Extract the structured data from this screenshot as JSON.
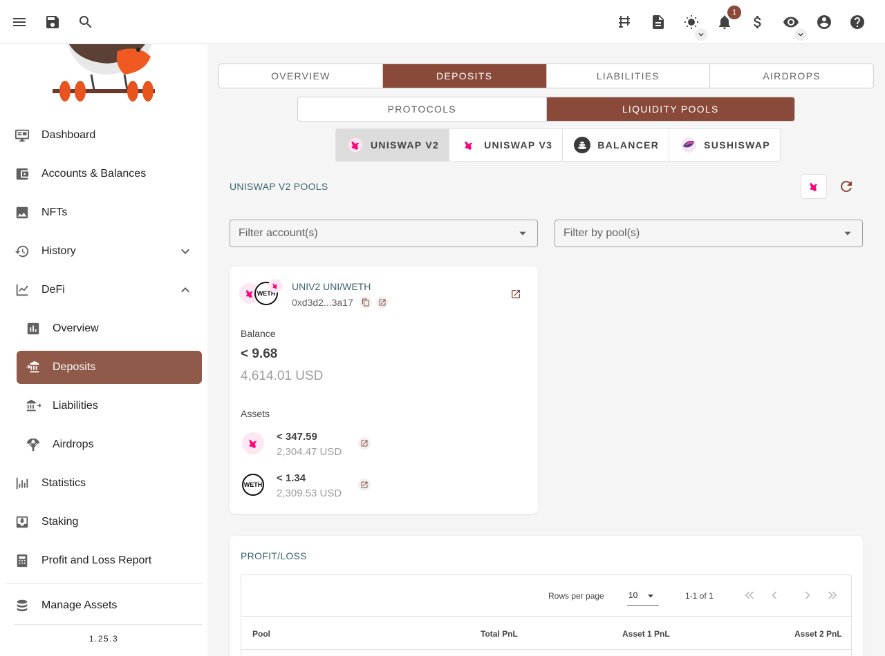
{
  "topbar": {
    "icons": [
      "menu-icon",
      "save-icon",
      "search-icon",
      "hub-icon",
      "notes-icon",
      "theme-icon",
      "notifications-icon",
      "currency-icon",
      "privacy-icon",
      "account-icon",
      "help-icon"
    ],
    "notification_count": "1"
  },
  "sidebar": {
    "items": [
      {
        "label": "Dashboard"
      },
      {
        "label": "Accounts & Balances"
      },
      {
        "label": "NFTs"
      },
      {
        "label": "History"
      },
      {
        "label": "DeFi"
      },
      {
        "label": "Overview"
      },
      {
        "label": "Deposits"
      },
      {
        "label": "Liabilities"
      },
      {
        "label": "Airdrops"
      },
      {
        "label": "Statistics"
      },
      {
        "label": "Staking"
      },
      {
        "label": "Profit and Loss Report"
      },
      {
        "label": "Manage Assets"
      }
    ],
    "version": "1.25.3"
  },
  "main_tabs": [
    "OVERVIEW",
    "DEPOSITS",
    "LIABILITIES",
    "AIRDROPS"
  ],
  "sub_tabs": [
    "PROTOCOLS",
    "LIQUIDITY POOLS"
  ],
  "protocol_tabs": [
    "UNISWAP V2",
    "UNISWAP V3",
    "BALANCER",
    "SUSHISWAP"
  ],
  "section_title": "UNISWAP V2 POOLS",
  "filters": {
    "account_placeholder": "Filter account(s)",
    "pool_placeholder": "Filter by pool(s)"
  },
  "pool_card": {
    "name": "UNIV2 UNI/WETH",
    "address": "0xd3d2...3a17",
    "balance_label": "Balance",
    "balance": "< 9.68",
    "balance_usd": "4,614.01 USD",
    "assets_label": "Assets",
    "assets": [
      {
        "amount": "< 347.59",
        "usd": "2,304.47 USD"
      },
      {
        "amount": "< 1.34",
        "usd": "2,309.53 USD"
      }
    ],
    "weth_text": "WETH"
  },
  "pnl": {
    "title": "PROFIT/LOSS",
    "rows_per_page_label": "Rows per page",
    "rows_per_page": "10",
    "page_info": "1-1 of 1",
    "columns": [
      "Pool",
      "Total PnL",
      "Asset 1 PnL",
      "Asset 2 PnL"
    ]
  },
  "colors": {
    "accent": "#8a4a3a",
    "teal": "#3a6470",
    "uniswap_pink": "#ff007a"
  }
}
